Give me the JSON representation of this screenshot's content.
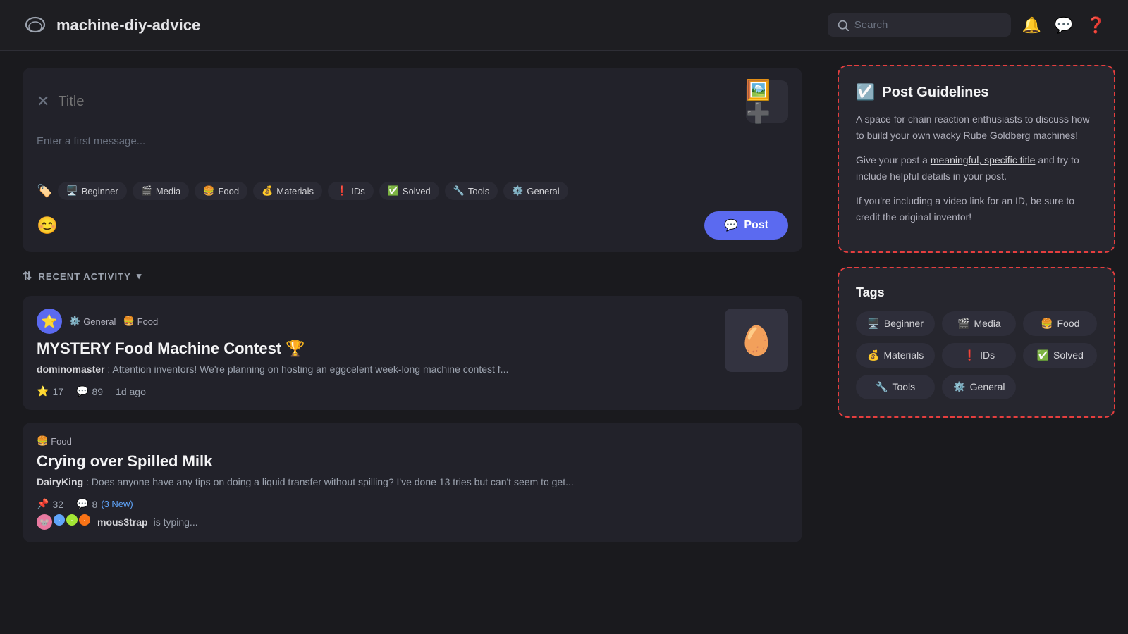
{
  "nav": {
    "channel": "machine-diy-advice",
    "search_placeholder": "Search",
    "channel_icon": "💬"
  },
  "compose": {
    "title_placeholder": "Title",
    "message_placeholder": "Enter a first message...",
    "post_label": "Post",
    "tags": [
      {
        "emoji": "🖥️",
        "label": "Beginner"
      },
      {
        "emoji": "🎬",
        "label": "Media"
      },
      {
        "emoji": "🍔",
        "label": "Food"
      },
      {
        "emoji": "💰",
        "label": "Materials"
      },
      {
        "emoji": "❗",
        "label": "IDs"
      },
      {
        "emoji": "✅",
        "label": "Solved"
      },
      {
        "emoji": "🔧",
        "label": "Tools"
      },
      {
        "emoji": "⚙️",
        "label": "General"
      }
    ]
  },
  "recent_activity": {
    "label": "RECENT ACTIVITY"
  },
  "threads": [
    {
      "id": 1,
      "avatar_emoji": "⭐",
      "tags": [
        {
          "emoji": "⚙️",
          "label": "General"
        },
        {
          "emoji": "🍔",
          "label": "Food"
        }
      ],
      "title": "MYSTERY Food Machine Contest 🏆",
      "author": "dominomaster",
      "preview": "Attention inventors! We're planning on hosting an eggcelent week-long machine contest f...",
      "stars": 17,
      "comments": 89,
      "time": "1d ago",
      "has_image": true,
      "image_emoji": "🥚"
    },
    {
      "id": 2,
      "tags": [
        {
          "emoji": "🍔",
          "label": "Food"
        }
      ],
      "title": "Crying over Spilled Milk",
      "author": "DairyKing",
      "preview": "Does anyone have any tips on doing a liquid transfer without spilling? I've done 13 tries but can't seem to get...",
      "pins": 32,
      "comments": 8,
      "new_comments": 3,
      "has_image": false,
      "typing": "mous3trap",
      "typing_suffix": "is typing..."
    }
  ],
  "guidelines": {
    "title": "Post Guidelines",
    "icon": "☑️",
    "paragraphs": [
      "A space for chain reaction enthusiasts to discuss how to build your own wacky Rube Goldberg machines!",
      "Give your post a meaningful, specific title and try to include helpful details in your post.",
      "If you're including a video link for an ID, be sure to credit the original inventor!"
    ],
    "link_text": "meaningful, specific title"
  },
  "tags_panel": {
    "title": "Tags",
    "tags": [
      {
        "emoji": "🖥️",
        "label": "Beginner"
      },
      {
        "emoji": "🎬",
        "label": "Media"
      },
      {
        "emoji": "🍔",
        "label": "Food"
      },
      {
        "emoji": "💰",
        "label": "Materials"
      },
      {
        "emoji": "❗",
        "label": "IDs"
      },
      {
        "emoji": "✅",
        "label": "Solved"
      },
      {
        "emoji": "🔧",
        "label": "Tools"
      },
      {
        "emoji": "⚙️",
        "label": "General"
      }
    ]
  }
}
